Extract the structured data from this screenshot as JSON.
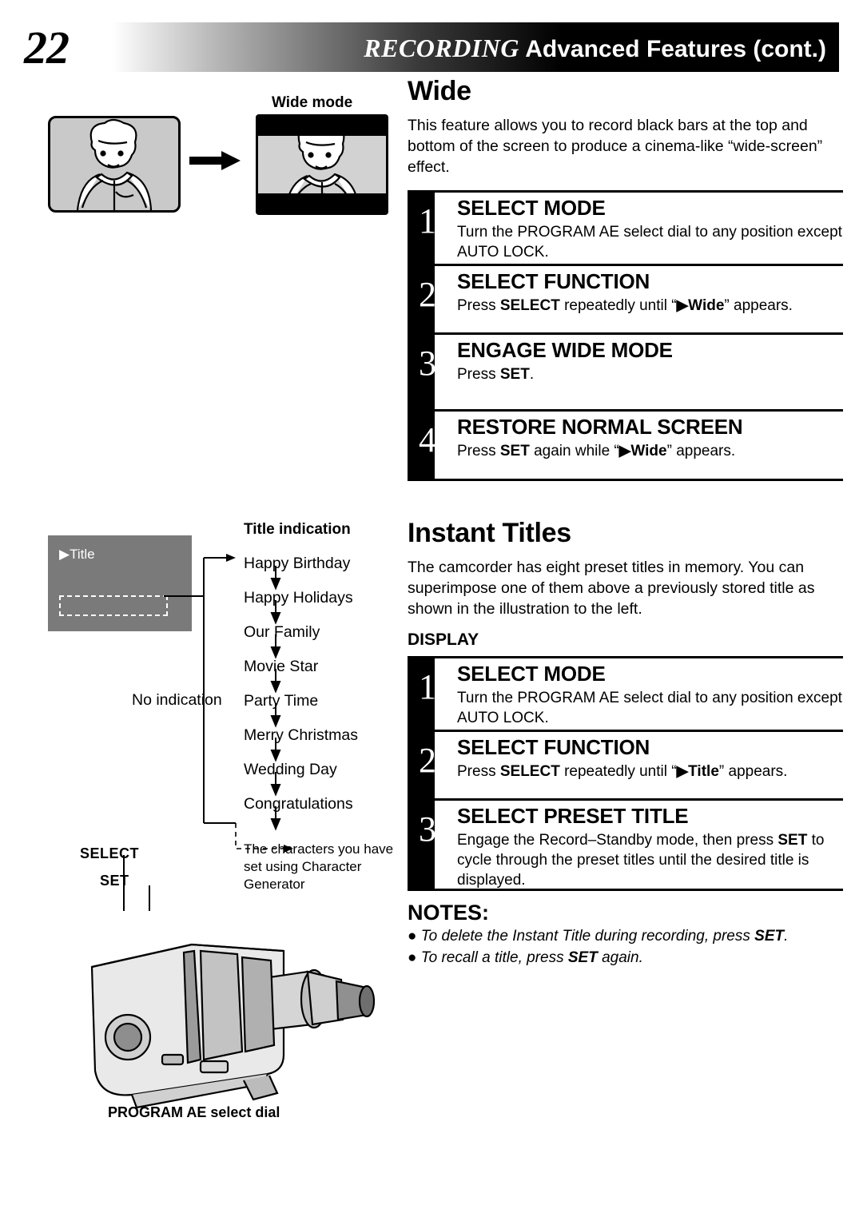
{
  "header": {
    "page_number": "22",
    "title_italic": "RECORDING",
    "title_rest": "Advanced Features (cont.)"
  },
  "wide_illustration": {
    "label": "Wide mode"
  },
  "wide_section": {
    "heading": "Wide",
    "intro": "This feature allows you to record black bars at the top and bottom of the screen to produce a cinema-like “wide-screen” effect.",
    "steps": [
      {
        "num": "1",
        "head": "SELECT MODE",
        "body_parts": [
          "Turn the PROGRAM AE select dial to any position except AUTO LOCK."
        ]
      },
      {
        "num": "2",
        "head": "SELECT FUNCTION",
        "body_pre": "Press ",
        "body_kw1": "SELECT",
        "body_mid": " repeatedly until “",
        "body_kw2": "▶Wide",
        "body_post": "” appears."
      },
      {
        "num": "3",
        "head": "ENGAGE WIDE MODE",
        "body_pre": "Press ",
        "body_kw1": "SET",
        "body_post": "."
      },
      {
        "num": "4",
        "head": "RESTORE NORMAL SCREEN",
        "body_pre": "Press ",
        "body_kw1": "SET",
        "body_mid": " again while “",
        "body_kw2": "▶Wide",
        "body_post": "” appears."
      }
    ]
  },
  "titles_section": {
    "heading": "Instant Titles",
    "intro": "The camcorder has eight preset titles in memory. You can superimpose one of them above a previously stored title as shown in the illustration to the left.",
    "display_label": "DISPLAY",
    "steps": [
      {
        "num": "1",
        "head": "SELECT MODE",
        "body_parts": [
          "Turn the PROGRAM AE select dial to any position except AUTO LOCK."
        ]
      },
      {
        "num": "2",
        "head": "SELECT FUNCTION",
        "body_pre": "Press ",
        "body_kw1": "SELECT",
        "body_mid": " repeatedly until “",
        "body_kw2": "▶Title",
        "body_post": "” appears."
      },
      {
        "num": "3",
        "head": "SELECT PRESET TITLE",
        "body_pre": "Engage the Record–Standby mode, then press ",
        "body_kw1": "SET",
        "body_mid": " to cycle through the preset titles until the desired title is displayed.",
        "body_post": ""
      }
    ],
    "notes_head": "NOTES:",
    "notes": [
      {
        "pre": "To delete the Instant Title during recording, press ",
        "kw": "SET",
        "post": "."
      },
      {
        "pre": "To recall a title, press ",
        "kw": "SET",
        "post": " again."
      }
    ]
  },
  "title_diagram": {
    "screen_text": "Title",
    "list_heading": "Title indication",
    "titles": [
      "Happy Birthday",
      "Happy Holidays",
      "Our Family",
      "Movie Star",
      "Party Time",
      "Merry Christmas",
      "Wedding Day",
      "Congratulations"
    ],
    "no_indication": "No indication",
    "char_note": "The characters you have set using Character Generator",
    "select_label": "SELECT",
    "set_label": "SET",
    "dial_label": "PROGRAM AE select dial"
  }
}
